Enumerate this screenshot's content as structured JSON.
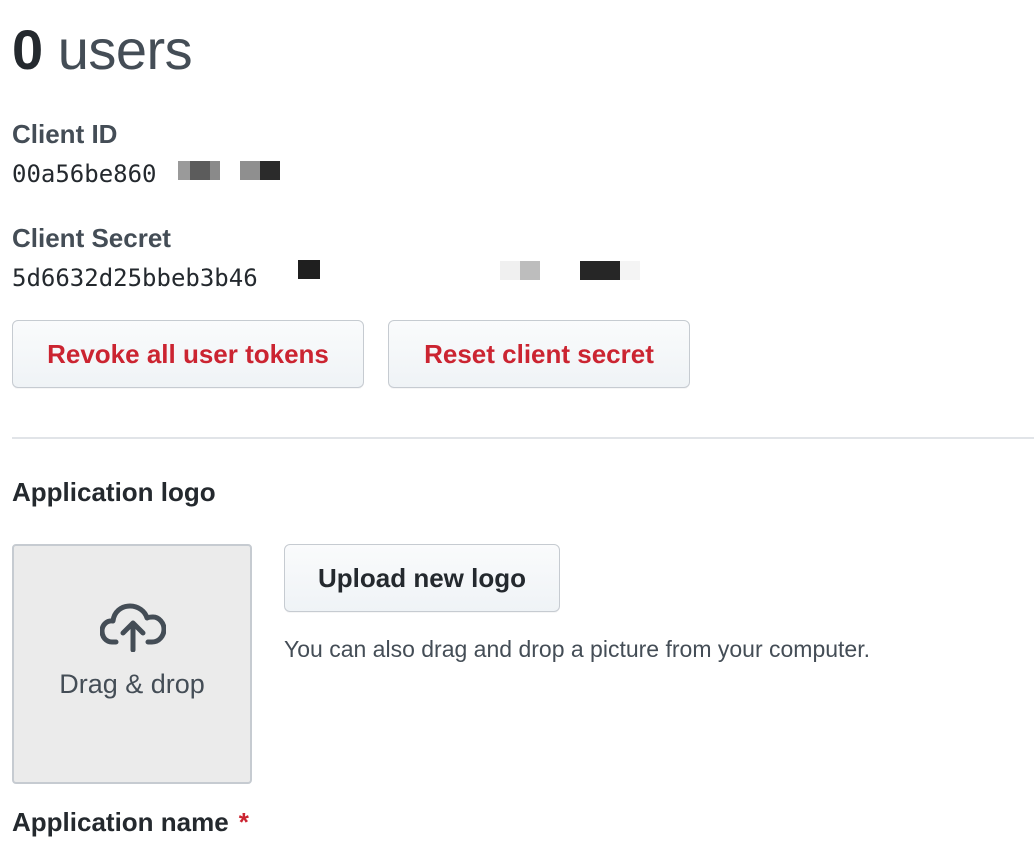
{
  "header": {
    "count": "0",
    "label": "users"
  },
  "client_id": {
    "label": "Client ID",
    "value": "00a56be860"
  },
  "client_secret": {
    "label": "Client Secret",
    "value": "5d6632d25bbeb3b46"
  },
  "actions": {
    "revoke_label": "Revoke all user tokens",
    "reset_label": "Reset client secret"
  },
  "logo": {
    "heading": "Application logo",
    "dropzone_label": "Drag & drop",
    "dropzone_icon": "cloud-upload-icon",
    "upload_label": "Upload new logo",
    "hint": "You can also drag and drop a picture from your computer."
  },
  "app_name": {
    "label": "Application name",
    "required_marker": "*"
  },
  "colors": {
    "danger": "#cb2431",
    "text": "#24292e",
    "muted": "#444d56",
    "border": "#c6cbd1"
  }
}
